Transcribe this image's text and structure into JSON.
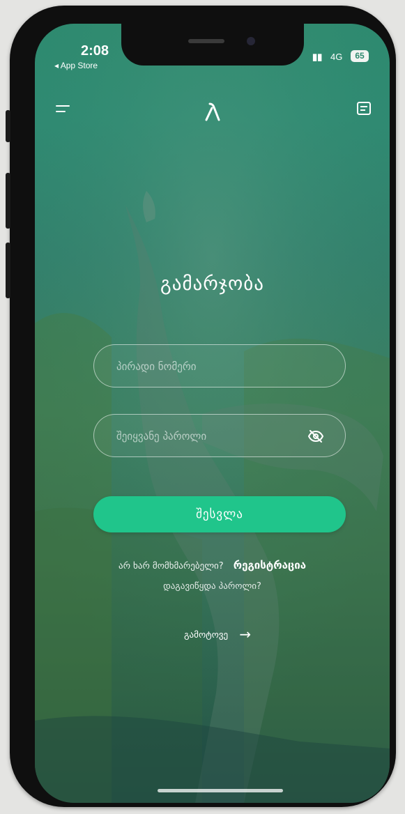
{
  "status_bar": {
    "time": "2:08",
    "back_app": "◂ App Store",
    "network": "4G",
    "battery": "65"
  },
  "header": {
    "logo_icon": "logo-lambda-icon",
    "menu_icon": "menu-icon",
    "chat_icon": "chat-icon"
  },
  "login": {
    "title": "გამარჯობა",
    "id_placeholder": "პირადი ნომერი",
    "password_placeholder": "შეიყვანე პაროლი",
    "submit_label": "შესვლა",
    "no_account_text": "არ ხარ მომხმარებელი?",
    "register_link": "რეგისტრაცია",
    "forgot_password": "დაგავიწყდა პაროლი?",
    "exit_label": "გამოტოვე"
  },
  "colors": {
    "accent": "#20c58b",
    "background": "#2e8a6f"
  }
}
